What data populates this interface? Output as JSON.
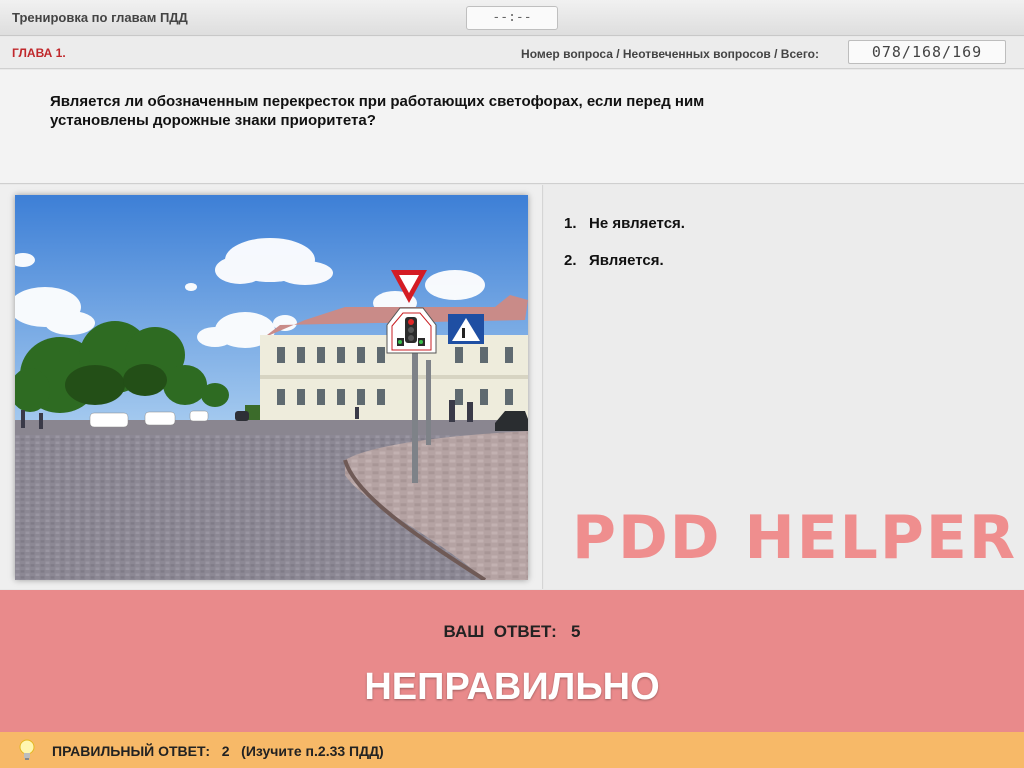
{
  "app": {
    "title": "Тренировка по главам ПДД",
    "timer": "--:--"
  },
  "subbar": {
    "chapter": "ГЛАВА 1.",
    "counter_label": "Номер вопроса / Неотвеченных вопросов / Всего:",
    "counter": "078/168/169"
  },
  "question": {
    "line1": "Является ли обозначенным перекресток при работающих светофорах, если перед ним",
    "line2": "установлены дорожные знаки приоритета?"
  },
  "answers": [
    {
      "num": "1.",
      "text": "Не является."
    },
    {
      "num": "2.",
      "text": "Является."
    }
  ],
  "watermark": "PDD HELPER",
  "result": {
    "your_answer_label": "ВАШ  ОТВЕТ:",
    "your_answer_value": "5",
    "verdict": "НЕПРАВИЛЬНО"
  },
  "hint": {
    "label": "ПРАВИЛЬНЫЙ ОТВЕТ:",
    "value": "2",
    "note": "(Изучите п.2.33 ПДД)"
  },
  "colors": {
    "error_bg": "#e98a8b",
    "hint_bg": "#f7b968",
    "chapter": "#c0282c"
  }
}
